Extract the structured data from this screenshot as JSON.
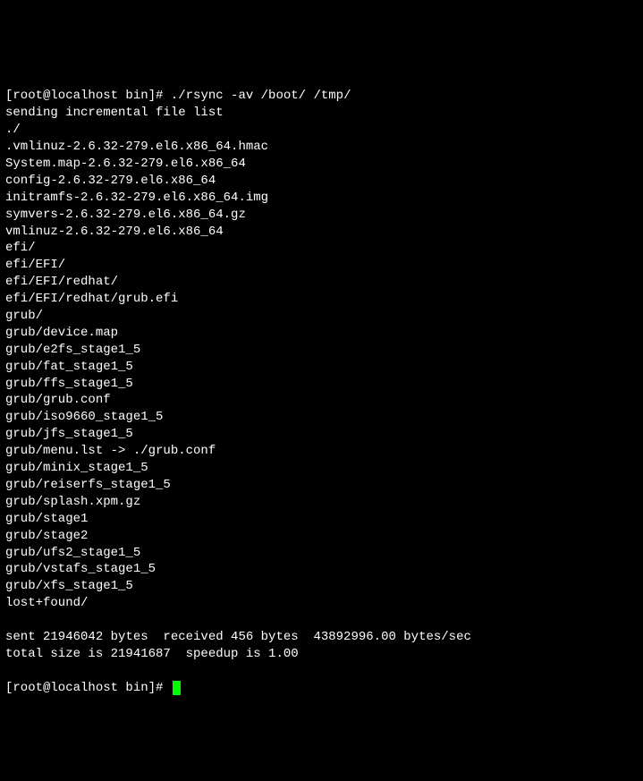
{
  "prompt1": "[root@localhost bin]# ",
  "command": "./rsync -av /boot/ /tmp/",
  "lines": [
    "sending incremental file list",
    "./",
    ".vmlinuz-2.6.32-279.el6.x86_64.hmac",
    "System.map-2.6.32-279.el6.x86_64",
    "config-2.6.32-279.el6.x86_64",
    "initramfs-2.6.32-279.el6.x86_64.img",
    "symvers-2.6.32-279.el6.x86_64.gz",
    "vmlinuz-2.6.32-279.el6.x86_64",
    "efi/",
    "efi/EFI/",
    "efi/EFI/redhat/",
    "efi/EFI/redhat/grub.efi",
    "grub/",
    "grub/device.map",
    "grub/e2fs_stage1_5",
    "grub/fat_stage1_5",
    "grub/ffs_stage1_5",
    "grub/grub.conf",
    "grub/iso9660_stage1_5",
    "grub/jfs_stage1_5",
    "grub/menu.lst -> ./grub.conf",
    "grub/minix_stage1_5",
    "grub/reiserfs_stage1_5",
    "grub/splash.xpm.gz",
    "grub/stage1",
    "grub/stage2",
    "grub/ufs2_stage1_5",
    "grub/vstafs_stage1_5",
    "grub/xfs_stage1_5",
    "lost+found/",
    "",
    "sent 21946042 bytes  received 456 bytes  43892996.00 bytes/sec",
    "total size is 21941687  speedup is 1.00"
  ],
  "prompt2": "[root@localhost bin]# "
}
